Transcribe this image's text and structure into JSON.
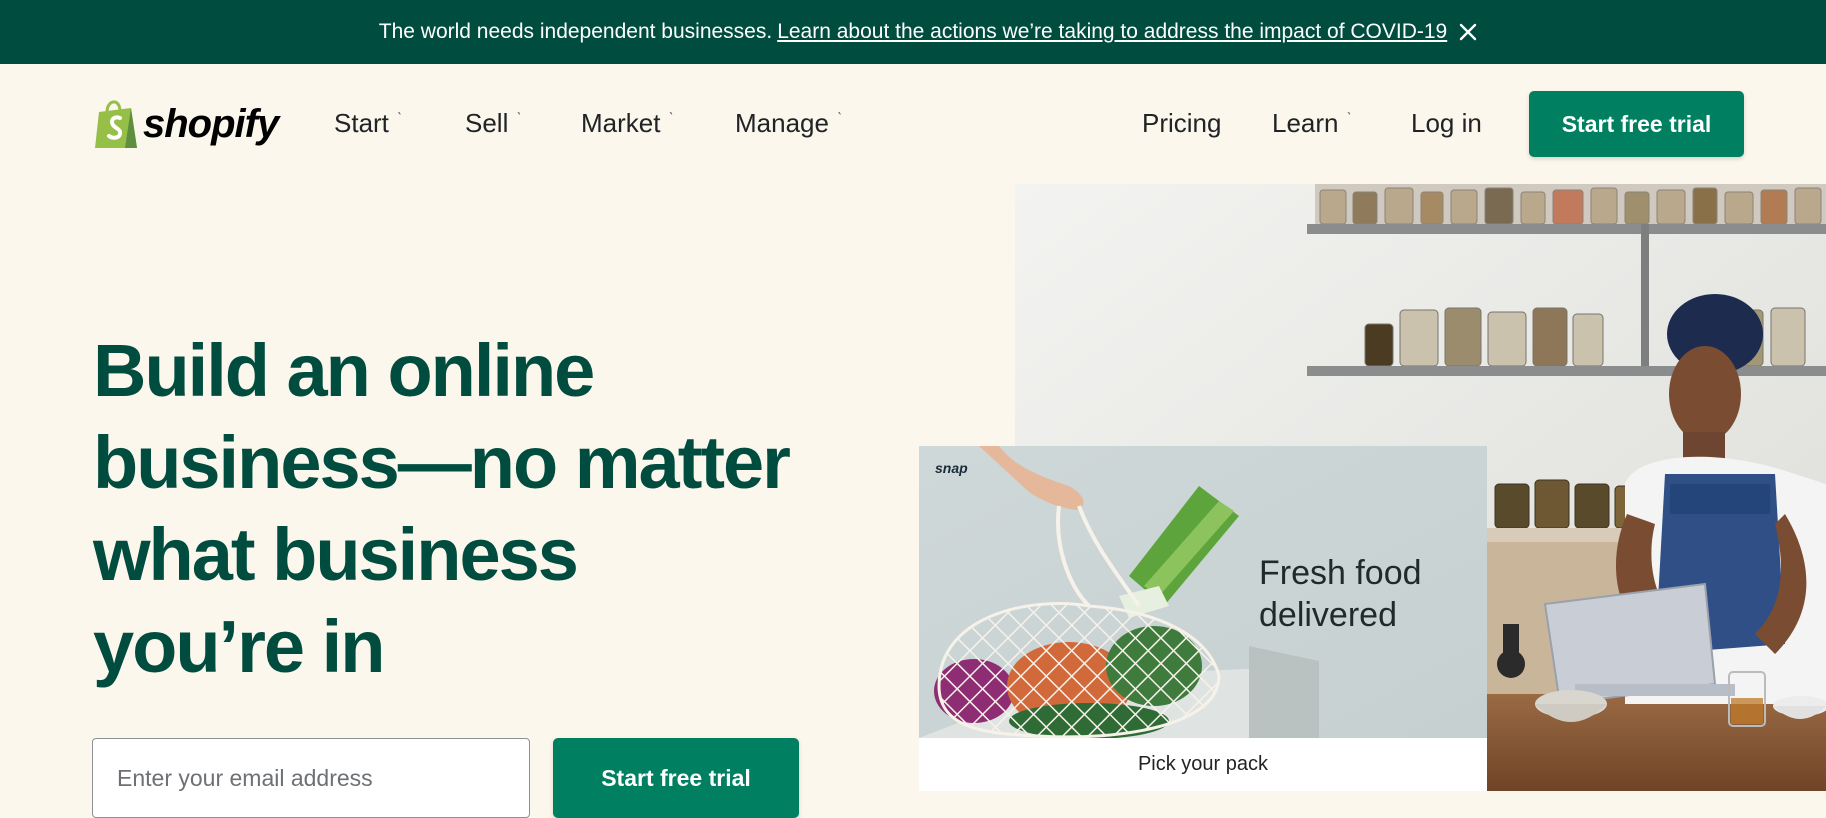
{
  "announcement": {
    "message": "The world needs independent businesses.",
    "link_text": "Learn about the actions we’re taking to address the impact of COVID-19",
    "close_icon": "close-icon"
  },
  "nav": {
    "logo_text": "shopify",
    "left_items": [
      {
        "label": "Start",
        "has_dropdown": true
      },
      {
        "label": "Sell",
        "has_dropdown": true
      },
      {
        "label": "Market",
        "has_dropdown": true
      },
      {
        "label": "Manage",
        "has_dropdown": true
      }
    ],
    "right_items": [
      {
        "label": "Pricing",
        "has_dropdown": false
      },
      {
        "label": "Learn",
        "has_dropdown": true
      },
      {
        "label": "Log in",
        "has_dropdown": false
      }
    ],
    "cta_label": "Start free trial",
    "chevron": "ˋ"
  },
  "hero": {
    "headline_lines": [
      "Build an online",
      "business—no matter",
      "what business",
      "you’re in"
    ],
    "email_placeholder": "Enter your email address",
    "cta_label": "Start free trial"
  },
  "showcase_card": {
    "brand": "snap",
    "headline_lines": [
      "Fresh food",
      "delivered"
    ],
    "footer_label": "Pick your pack"
  },
  "colors": {
    "brand_dark_green": "#004c3f",
    "cta_green": "#008060",
    "page_bg": "#fbf7ed",
    "logo_green": "#95bf47"
  }
}
